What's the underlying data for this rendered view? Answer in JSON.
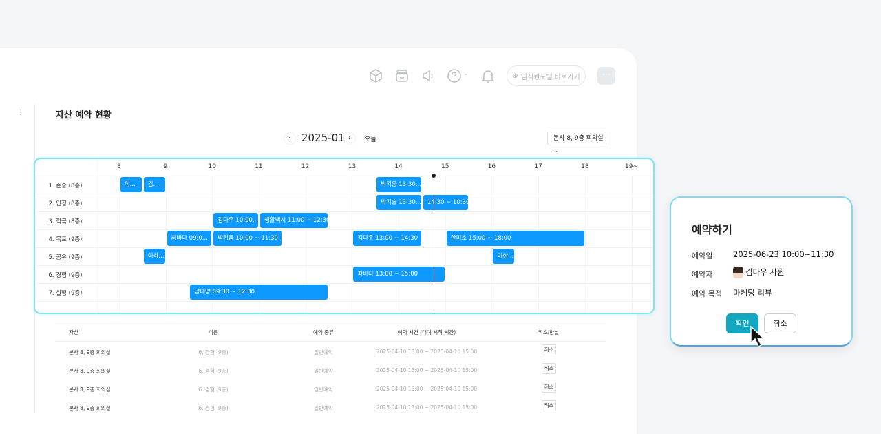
{
  "topbar": {
    "icons": [
      "cube-icon",
      "archive-icon",
      "megaphone-icon",
      "help-icon",
      "bell-icon"
    ],
    "portal_label": "임직원포털 바로가기",
    "more_label": "···"
  },
  "page": {
    "title": "자산 예약 현황",
    "month": "2025-01",
    "today_label": "오늘",
    "filter": "본사 8, 9층 회의실"
  },
  "timeline": {
    "hours": [
      "8",
      "9",
      "10",
      "11",
      "12",
      "13",
      "14",
      "15",
      "16",
      "17",
      "18",
      "19~"
    ],
    "rows": [
      "1. 존중 (8층)",
      "2. 인정 (8층)",
      "3. 적극 (8층)",
      "4. 목표 (9층)",
      "5. 공유 (9층)",
      "6. 경험 (9층)",
      "7. 실행 (9층)"
    ],
    "current_time": 14.75,
    "bar_color": "#0d99ff",
    "bookings": [
      {
        "row": 0,
        "start": 8.0,
        "end": 8.5,
        "label": "이..."
      },
      {
        "row": 0,
        "start": 8.5,
        "end": 9.0,
        "label": "김..."
      },
      {
        "row": 0,
        "start": 13.5,
        "end": 14.5,
        "label": "박키움 13:30..."
      },
      {
        "row": 1,
        "start": 13.5,
        "end": 14.5,
        "label": "박기술 13:30..."
      },
      {
        "row": 1,
        "start": 14.5,
        "end": 15.5,
        "label": "14:30 ~ 10:30"
      },
      {
        "row": 2,
        "start": 10.0,
        "end": 11.0,
        "label": "김다우 10:00..."
      },
      {
        "row": 2,
        "start": 11.0,
        "end": 12.5,
        "label": "생활백서 11:00 ~ 12:30"
      },
      {
        "row": 3,
        "start": 9.0,
        "end": 10.0,
        "label": "최바다 09:0..."
      },
      {
        "row": 3,
        "start": 10.0,
        "end": 11.5,
        "label": "박키움 10:00 ~ 11:30"
      },
      {
        "row": 3,
        "start": 13.0,
        "end": 14.5,
        "label": "김다우 13:00 ~ 14:30"
      },
      {
        "row": 3,
        "start": 15.0,
        "end": 18.0,
        "label": "한미소 15:00 ~ 18:00"
      },
      {
        "row": 4,
        "start": 8.5,
        "end": 9.0,
        "label": "이하..."
      },
      {
        "row": 4,
        "start": 16.0,
        "end": 16.5,
        "label": "이한..."
      },
      {
        "row": 5,
        "start": 13.0,
        "end": 15.0,
        "label": "최바다 13:00 ~ 15:00"
      },
      {
        "row": 6,
        "start": 9.5,
        "end": 12.5,
        "label": "남태양 09:30 ~ 12:30"
      }
    ]
  },
  "table": {
    "headers": [
      "자산",
      "이름",
      "예약 종류",
      "예약 시간 (대여 시작 시간)",
      "취소/반납"
    ],
    "rows": [
      {
        "asset": "본사 8, 9층 회의실",
        "name": "6. 경험 (9층)",
        "type": "일반예약",
        "time": "2025-04-10 13:00 ~ 2025-04-10 15:00",
        "action": "취소"
      },
      {
        "asset": "본사 8, 9층 회의실",
        "name": "6. 경험 (9층)",
        "type": "일반예약",
        "time": "2025-04-10 13:00 ~ 2025-04-10 15:00",
        "action": "취소"
      },
      {
        "asset": "본사 8, 9층 회의실",
        "name": "6. 경험 (9층)",
        "type": "일반예약",
        "time": "2025-04-10 13:00 ~ 2025-04-10 15:00",
        "action": "취소"
      },
      {
        "asset": "본사 8, 9층 회의실",
        "name": "6. 경험 (9층)",
        "type": "일반예약",
        "time": "2025-04-10 13:00 ~ 2025-04-10 15:00",
        "action": "취소"
      }
    ]
  },
  "modal": {
    "title": "예약하기",
    "date_label": "예약일",
    "date_value": "2025-06-23  10:00~11:30",
    "booker_label": "예약자",
    "booker_value": "김다우 사원",
    "purpose_label": "예약 목적",
    "purpose_value": "마케팅 리뷰",
    "confirm": "확인",
    "cancel": "취소"
  }
}
